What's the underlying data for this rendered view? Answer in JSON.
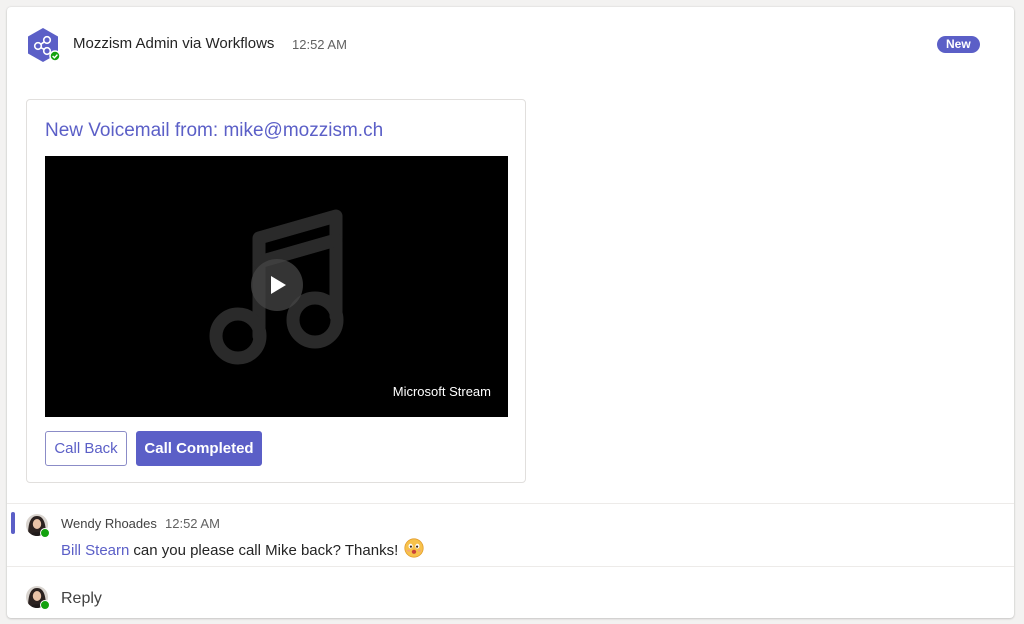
{
  "post": {
    "sender": "Mozzism Admin via Workflows",
    "time": "12:52 AM",
    "badge": "New",
    "app_icon": "workflows-icon",
    "colors": {
      "accent": "#5b5fc7",
      "presence": "#13a10e"
    }
  },
  "card": {
    "title": "New Voicemail from: mike@mozzism.ch",
    "video": {
      "placeholder_icon": "music-note-icon",
      "play_icon": "play-icon",
      "brand": "Microsoft Stream"
    },
    "buttons": {
      "call_back": "Call Back",
      "call_completed": "Call Completed"
    }
  },
  "reply_message": {
    "author": "Wendy Rhoades",
    "time": "12:52 AM",
    "mention": "Bill Stearn",
    "text": "can you please call Mike back? Thanks!",
    "emoji_icon": "smiling-face-emoji"
  },
  "reply_box": {
    "placeholder": "Reply"
  }
}
